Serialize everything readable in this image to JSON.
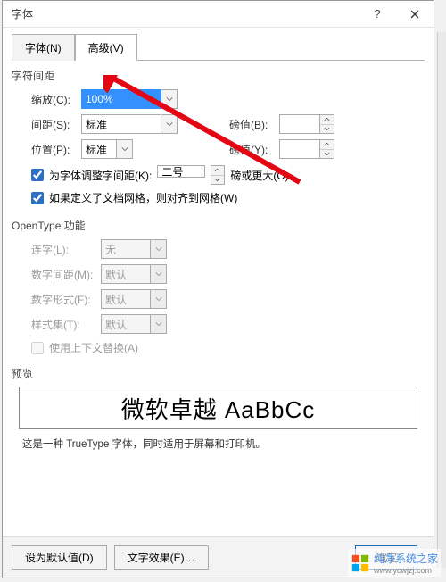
{
  "titlebar": {
    "title": "字体"
  },
  "tabs": {
    "font": "字体(N)",
    "advanced": "高级(V)"
  },
  "charSpacing": {
    "title": "字符间距",
    "scale_label": "缩放(C):",
    "scale_value": "100%",
    "spacing_label": "间距(S):",
    "spacing_value": "标准",
    "position_label": "位置(P):",
    "position_value": "标准",
    "points_label": "磅值(B):",
    "points_value": "",
    "points2_label": "磅值(Y):",
    "points2_value": "",
    "kerning_label": "为字体调整字间距(K):",
    "kerning_value": "二号",
    "kerning_suffix": "磅或更大(O)",
    "snap_label": "如果定义了文档网格，则对齐到网格(W)"
  },
  "opentype": {
    "title": "OpenType 功能",
    "ligature_label": "连字(L):",
    "ligature_value": "无",
    "numspacing_label": "数字间距(M):",
    "numspacing_value": "默认",
    "numform_label": "数字形式(F):",
    "numform_value": "默认",
    "styleset_label": "样式集(T):",
    "styleset_value": "默认",
    "contextual_label": "使用上下文替换(A)"
  },
  "preview": {
    "title": "预览",
    "sample": "微软卓越  AaBbCc",
    "caption": "这是一种 TrueType 字体，同时适用于屏幕和打印机。"
  },
  "footer": {
    "default": "设为默认值(D)",
    "effects": "文字效果(E)…",
    "ok": "确定"
  },
  "watermark": {
    "site": "纯净系统之家",
    "url": "www.ycwjzj.com"
  }
}
